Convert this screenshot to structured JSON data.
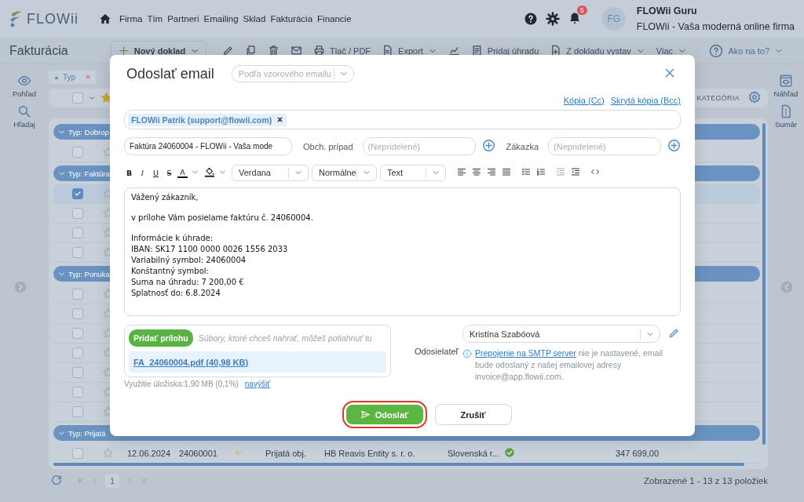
{
  "header": {
    "logo": "FLOWii",
    "nav": [
      "Firma",
      "Tím",
      "Partneri",
      "Emailing",
      "Sklad",
      "Fakturácia",
      "Financie"
    ],
    "notifications": "5",
    "avatar": "FG",
    "user_name": "FLOWii Guru",
    "company": "FLOWii - Vaša moderná online firma"
  },
  "toolbar": {
    "title": "Fakturácia",
    "items": [
      {
        "kind": "new",
        "label": "Nový doklad"
      },
      {
        "kind": "edit"
      },
      {
        "kind": "copy"
      },
      {
        "kind": "delete"
      },
      {
        "kind": "email"
      },
      {
        "kind": "print",
        "label": "Tlač / PDF"
      },
      {
        "kind": "export",
        "label": "Export"
      },
      {
        "kind": "stats"
      },
      {
        "kind": "payment",
        "label": "Pridaj úhradu"
      },
      {
        "kind": "derive",
        "label": "Z dokladu vystav"
      },
      {
        "kind": "more",
        "label": "Viac"
      },
      {
        "kind": "help",
        "label": "Ako na to?"
      }
    ]
  },
  "left_rail": [
    {
      "kind": "view",
      "label": "Pohľad"
    },
    {
      "kind": "search",
      "label": "Hľadaj"
    }
  ],
  "right_rail": [
    {
      "kind": "preview",
      "label": "Náhľad"
    },
    {
      "kind": "summary",
      "label": "Sumár"
    }
  ],
  "filter_chip": {
    "label": "Typ"
  },
  "select_all": {
    "checked": false
  },
  "column_header": "KATEGÓRIA",
  "list": {
    "groups": [
      {
        "label": "Typ: Dobrop",
        "rows": [
          {
            "checked": false
          }
        ]
      },
      {
        "label": "Typ: Faktúra",
        "rows": [
          {
            "checked": true
          },
          {
            "checked": false
          },
          {
            "checked": false
          },
          {
            "checked": false
          }
        ]
      },
      {
        "label": "Typ: Ponuka",
        "rows": [
          {
            "checked": false
          },
          {
            "checked": false
          },
          {
            "checked": false
          },
          {
            "checked": false
          },
          {
            "checked": false
          },
          {
            "checked": false
          },
          {
            "checked": false
          }
        ]
      },
      {
        "label": "Typ: Prijatá",
        "rows": [
          {
            "checked": false,
            "date": "12.06.2024",
            "number": "24060001",
            "type": "Prijatá obj.",
            "partner": "HB Reavis Entity s. r. o.",
            "country": "Slovenská r...",
            "amount": "347 699,00"
          }
        ]
      }
    ]
  },
  "footer": {
    "page": "1",
    "summary": "Zobrazené 1 - 13 z 13 položiek"
  },
  "email_modal": {
    "title": "Odoslať email",
    "template": {
      "placeholder": "Podľa vzorového emailu"
    },
    "cc_link": "Kópia (Cc)",
    "bcc_link": "Skrytá kópia (Bcc)",
    "recipients": [
      "FLOWii Patrik (support@flowii.com)"
    ],
    "subject": "Faktúra 24060004 - FLOWii - Vaša mode",
    "business_case": {
      "label": "Obch. prípad",
      "placeholder": "(Nepridelené)"
    },
    "order": {
      "label": "Zákazka",
      "placeholder": "(Nepridelené)"
    },
    "format_buttons": [
      {
        "kind": "bold",
        "label": "B"
      },
      {
        "kind": "italic",
        "label": "I"
      },
      {
        "kind": "underline",
        "label": "U"
      },
      {
        "kind": "strike",
        "label": "S"
      },
      {
        "kind": "color",
        "label": "A"
      }
    ],
    "font": "Verdana",
    "size": "Normálne",
    "style": "Text",
    "body": [
      [
        "Vážený zákazník,"
      ],
      [
        "v prílohe Vám posielame faktúru č. 24060004."
      ],
      [
        "Informácie k úhrade:",
        "IBAN: SK17 1100 0000 0026 1556 2033",
        "Variabilný symbol: 24060004",
        "Konštantný symbol:",
        "Suma na úhradu: 7 200,00 €",
        "Splatnosť do: 6.8.2024"
      ]
    ],
    "attach_button": "Pridať prílohu",
    "attach_hint": "Súbory, ktoré chceš nahrať, môžeš potiahnuť tu",
    "attachments": [
      "FA_24060004.pdf (40,98 KB)"
    ],
    "storage": "Využitie úložiska:1,90 MB (0,1%)",
    "storage_link": "navýšiť",
    "sender_label": "Odosielateľ",
    "sender": "Kristína Szabóová",
    "smtp_link": "Prepojenie na SMTP server",
    "smtp_note": "nie je nastavené, email bude odoslaný z našej emailovej adresy invoice@app.flowii.com.",
    "send": "Odoslať",
    "cancel": "Zrušiť"
  }
}
